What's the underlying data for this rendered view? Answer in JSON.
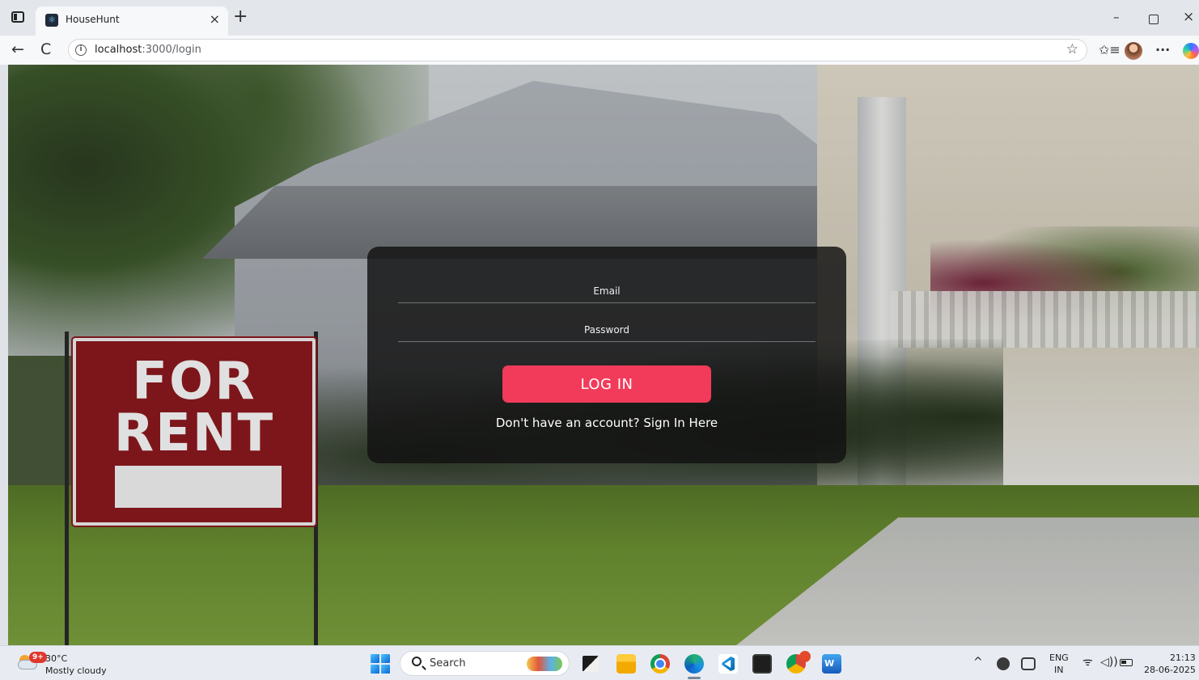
{
  "browser": {
    "tab_title": "HouseHunt",
    "tab_favicon": "react-favicon-icon",
    "url_host": "localhost",
    "url_path": ":3000/login",
    "icons": {
      "back": "←",
      "reload": "C",
      "info": "i",
      "star": "☆",
      "favorites": "✩≡",
      "more": "···",
      "new_tab": "+",
      "close_tab": "×",
      "minimize": "–",
      "close_window": "×"
    }
  },
  "background": {
    "sign_line1": "FOR",
    "sign_line2": "RENT"
  },
  "login": {
    "email_placeholder": "Email",
    "password_placeholder": "Password",
    "submit_label": "LOG IN",
    "signup_prompt": "Don't have an account? Sign In Here",
    "colors": {
      "button": "#f23b5a",
      "card": "#121212"
    }
  },
  "taskbar": {
    "weather": {
      "badge": "9+",
      "temperature": "30°C",
      "condition": "Mostly cloudy"
    },
    "search_label": "Search",
    "tray": {
      "chevron": "^",
      "lang_line1": "ENG",
      "lang_line2": "IN",
      "wifi": "ᯤ",
      "volume": "◁))"
    },
    "clock": {
      "time": "21:13",
      "date": "28-06-2025"
    }
  }
}
